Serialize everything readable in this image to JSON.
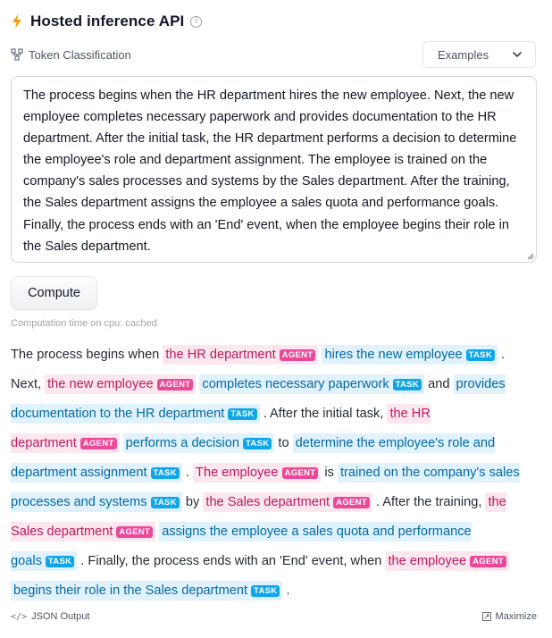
{
  "header": {
    "title": "Hosted inference API",
    "info_icon": "info-icon",
    "bolt_icon": "lightning-icon",
    "bolt_color": "#f59e0b"
  },
  "task": {
    "icon": "token-classification-icon",
    "label": "Token Classification"
  },
  "examples": {
    "label": "Examples",
    "icon": "chevron-down-icon"
  },
  "input": {
    "value": "The process begins when the HR department hires the new employee. Next, the new employee completes necessary paperwork and provides documentation to the HR department. After the initial task, the HR department performs a  decision to determine the employee's role and department assignment. The employee is trained on the company's sales processes and systems by the Sales department. After the training, the Sales department assigns the employee a sales quota and performance goals. Finally, the process ends with an 'End' event, when the employee begins their role in the Sales department."
  },
  "compute": {
    "label": "Compute"
  },
  "computation_time": "Computation time on cpu: cached",
  "colors": {
    "agent_bg": "#fce7ef",
    "agent_text": "#be185d",
    "agent_tag": "#ec4899",
    "task_bg": "#e0f2fe",
    "task_text": "#0369a1",
    "task_tag": "#0ea5e9"
  },
  "output_segments": [
    {
      "type": "text",
      "text": "The process begins when "
    },
    {
      "type": "agent",
      "text": "the HR department",
      "tag": "AGENT"
    },
    {
      "type": "text",
      "text": " "
    },
    {
      "type": "task",
      "text": "hires the new employee",
      "tag": "TASK"
    },
    {
      "type": "text",
      "text": " . Next, "
    },
    {
      "type": "agent",
      "text": "the new employee",
      "tag": "AGENT"
    },
    {
      "type": "text",
      "text": " "
    },
    {
      "type": "task",
      "text": "completes necessary paperwork",
      "tag": "TASK"
    },
    {
      "type": "text",
      "text": " and "
    },
    {
      "type": "task",
      "text": "provides documentation to the HR department",
      "tag": "TASK"
    },
    {
      "type": "text",
      "text": " . After the initial task, "
    },
    {
      "type": "agent",
      "text": "the HR department",
      "tag": "AGENT"
    },
    {
      "type": "text",
      "text": " "
    },
    {
      "type": "task",
      "text": "performs a decision",
      "tag": "TASK"
    },
    {
      "type": "text",
      "text": " to "
    },
    {
      "type": "task",
      "text": "determine the employee's role and department assignment",
      "tag": "TASK"
    },
    {
      "type": "text",
      "text": " . "
    },
    {
      "type": "agent",
      "text": "The employee",
      "tag": "AGENT"
    },
    {
      "type": "text",
      "text": " is "
    },
    {
      "type": "task",
      "text": "trained on the company's sales processes and systems",
      "tag": "TASK"
    },
    {
      "type": "text",
      "text": " by "
    },
    {
      "type": "agent",
      "text": "the Sales department",
      "tag": "AGENT"
    },
    {
      "type": "text",
      "text": " . After the training, "
    },
    {
      "type": "agent",
      "text": "the Sales department",
      "tag": "AGENT"
    },
    {
      "type": "text",
      "text": " "
    },
    {
      "type": "task",
      "text": "assigns the employee a sales quota and performance goals",
      "tag": "TASK"
    },
    {
      "type": "text",
      "text": " . Finally, the process ends with an 'End' event, when "
    },
    {
      "type": "agent",
      "text": "the employee",
      "tag": "AGENT"
    },
    {
      "type": "text",
      "text": " "
    },
    {
      "type": "task",
      "text": "begins their role in the Sales department",
      "tag": "TASK"
    },
    {
      "type": "text",
      "text": " ."
    }
  ],
  "footer": {
    "json_label": "JSON Output",
    "json_icon": "code-icon",
    "maximize_label": "Maximize",
    "maximize_icon": "maximize-icon"
  }
}
